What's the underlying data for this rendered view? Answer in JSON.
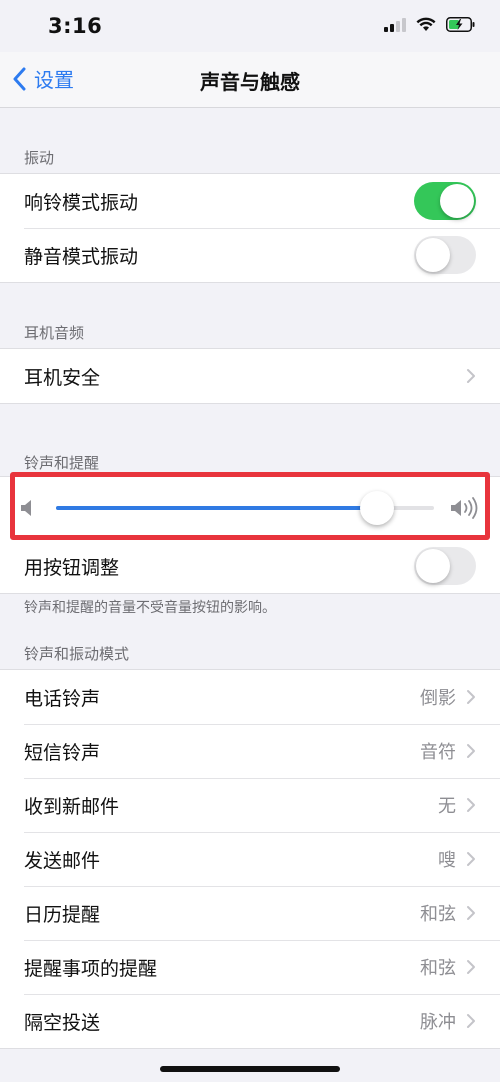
{
  "status_bar": {
    "time": "3:16"
  },
  "nav": {
    "back_label": "设置",
    "title": "声音与触感"
  },
  "sections": {
    "vibration": {
      "header": "振动",
      "rows": [
        {
          "label": "响铃模式振动",
          "toggle": "on"
        },
        {
          "label": "静音模式振动",
          "toggle": "off"
        }
      ]
    },
    "headphone": {
      "header": "耳机音频",
      "rows": [
        {
          "label": "耳机安全"
        }
      ]
    },
    "ringer": {
      "header": "铃声和提醒",
      "volume_level": 0.85,
      "adjust_label": "用按钮调整",
      "adjust_toggle": "off",
      "footer": "铃声和提醒的音量不受音量按钮的影响。"
    },
    "patterns": {
      "header": "铃声和振动模式",
      "rows": [
        {
          "label": "电话铃声",
          "value": "倒影"
        },
        {
          "label": "短信铃声",
          "value": "音符"
        },
        {
          "label": "收到新邮件",
          "value": "无"
        },
        {
          "label": "发送邮件",
          "value": "嗖"
        },
        {
          "label": "日历提醒",
          "value": "和弦"
        },
        {
          "label": "提醒事项的提醒",
          "value": "和弦"
        },
        {
          "label": "隔空投送",
          "value": "脉冲"
        }
      ]
    }
  },
  "colors": {
    "accent": "#2d7bf0",
    "toggle_on": "#34c759",
    "highlight": "#e8343c"
  }
}
